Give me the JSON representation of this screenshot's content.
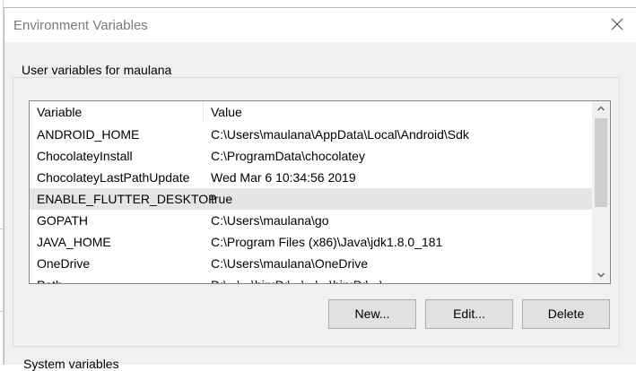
{
  "window": {
    "title": "Environment Variables"
  },
  "user_vars": {
    "group_label": "User variables for maulana",
    "columns": {
      "name": "Variable",
      "value": "Value"
    },
    "rows": [
      {
        "name": "ANDROID_HOME",
        "value": "C:\\Users\\maulana\\AppData\\Local\\Android\\Sdk"
      },
      {
        "name": "ChocolateyInstall",
        "value": "C:\\ProgramData\\chocolatey"
      },
      {
        "name": "ChocolateyLastPathUpdate",
        "value": "Wed Mar  6 10:34:56 2019"
      },
      {
        "name": "ENABLE_FLUTTER_DESKTOP",
        "value": "true",
        "selected": true
      },
      {
        "name": "GOPATH",
        "value": "C:\\Users\\maulana\\go"
      },
      {
        "name": "JAVA_HOME",
        "value": "C:\\Program Files (x86)\\Java\\jdk1.8.0_181"
      },
      {
        "name": "OneDrive",
        "value": "C:\\Users\\maulana\\OneDrive"
      },
      {
        "name": "Path",
        "value": "D:\\...\\...\\bin;D:\\...\\...\\...\\bin;D:\\...\\..."
      }
    ],
    "buttons": {
      "new": "New...",
      "edit": "Edit...",
      "delete": "Delete"
    }
  },
  "system_vars": {
    "group_label": "System variables"
  },
  "colors": {
    "dialog_bg": "#f0f0f0",
    "selected_row": "#e5e5e5",
    "button_bg": "#e1e1e1"
  }
}
